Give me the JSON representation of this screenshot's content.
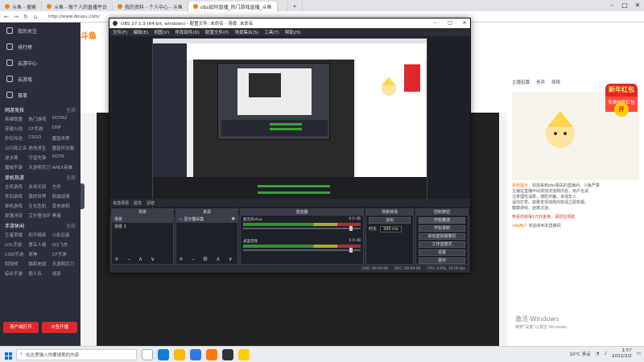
{
  "browser": {
    "tabs": [
      {
        "label": "斗鱼 - 搜索",
        "active": false
      },
      {
        "label": "斗鱼 - 每个人的直播平台",
        "active": false
      },
      {
        "label": "我的资料 - 个人中心 - 斗鱼",
        "active": false
      },
      {
        "label": "obs如何直播_热门游戏直播_斗鱼",
        "active": true
      },
      {
        "label": "",
        "active": false
      }
    ],
    "url": "http://www.douyu.com/"
  },
  "leftnav": {
    "items": [
      "我的关注",
      "排行榜",
      "云游中心",
      "云游戏",
      "赛事"
    ],
    "groups": [
      {
        "title": "网游竞技",
        "more": "全部",
        "items": [
          "英雄联盟",
          "热门游戏",
          "DOTA2",
          "穿越火线",
          "CF手游",
          "DNF",
          "炉石传说",
          "CSGO",
          "魔兽世界",
          "以闪亮之名",
          "绝地求生",
          "魔兽怀旧服",
          "逆水寒",
          "守望先锋",
          "DOTA",
          "魔域手游",
          "天涯明月刀",
          "APEX英雄"
        ]
      },
      {
        "title": "单机热游",
        "more": "全部",
        "items": [
          "主机游戏",
          "永劫无间",
          "方舟",
          "怀旧游戏",
          "我的世界",
          "刺激战场",
          "单机游戏",
          "生化危机",
          "其他单机",
          "部落冲突",
          "艾尔登法环",
          "黑魂"
        ]
      },
      {
        "title": "手游休闲",
        "more": "全部",
        "items": [
          "王者荣耀",
          "和平精英",
          "火影忍者",
          "LOL手游",
          "第五人格",
          "QQ飞车",
          "COD手游",
          "原神",
          "CF手游",
          "阴阳师",
          "猫和老鼠",
          "天涯明月刀",
          "综合手游",
          "狼人杀",
          "战双"
        ]
      }
    ],
    "red_buttons": [
      "客户端打开",
      "斗鱼开播"
    ]
  },
  "page": {
    "logo": "斗鱼",
    "right_tabs": [
      "主播招募",
      "贵宾",
      "周榜"
    ],
    "chat": [
      {
        "name": "系统提示：",
        "text": "欢迎来到obs相关的直播间，斗鱼严禁"
      },
      {
        "name": "",
        "text": "主播在直播中出现违法违规内容，用户也请"
      },
      {
        "name": "",
        "text": "注意理性消费，谨防诈骗，未成年人"
      },
      {
        "name": "",
        "text": "请勿打赏。如果发现违规内容请立即举报。"
      },
      {
        "name": "",
        "text": "健康游戏，远离沉迷。"
      }
    ],
    "chat_sys": "恭喜你获得1元代金券，请前往领取",
    "chat_user": "cda用户",
    "chat_user_action": "欢迎来到本直播间",
    "ny_top": "新年红包",
    "ny_bottom": "免费抽取红包",
    "ny_open": "开",
    "watermark_title": "激活 Windows",
    "watermark_sub": "转到\"设置\"以激活 Windows。"
  },
  "obs": {
    "title": "OBS 27.1.3 (64-bit, windows) - 配置文件: 未命名 - 场景: 未命名",
    "menu": [
      "文件(F)",
      "编辑(E)",
      "视图(V)",
      "停靠部件(D)",
      "配置文件(P)",
      "场景集合(S)",
      "工具(T)",
      "帮助(H)"
    ],
    "scene_header": [
      "未选择源",
      "属性",
      "滤镜"
    ],
    "docks": {
      "scenes": {
        "title": "场景",
        "items": [
          "场景",
          "场景 2"
        ]
      },
      "sources": {
        "title": "来源",
        "items": [
          "显示器采集"
        ]
      },
      "mixer": {
        "title": "混音器",
        "tracks": [
          {
            "name": "麦克风/Aux",
            "db": "0.0 dB"
          },
          {
            "name": "桌面音频",
            "db": "0.0 dB"
          }
        ]
      },
      "transitions": {
        "title": "场景转场",
        "type": "淡出",
        "duration_label": "时长",
        "duration": "300 ms"
      },
      "controls": {
        "title": "控制按钮",
        "buttons": [
          "开始推流",
          "开始录制",
          "启动虚拟摄像机",
          "工作室模式",
          "设置",
          "退出"
        ]
      }
    },
    "status": [
      "LIVE: 00:00:00",
      "REC: 00:00:00",
      "CPU: 0.9%, 30.00 fps"
    ]
  },
  "taskbar": {
    "search_placeholder": "在这里输入你要搜索的内容",
    "weather": "10°C 多云",
    "time": "1:57",
    "date": "2022/2/2"
  },
  "colors": {
    "accent": "#ff7a00",
    "red": "#e0282b",
    "obs_bg": "#2b2e38",
    "nav_bg": "#2a2d3a"
  }
}
